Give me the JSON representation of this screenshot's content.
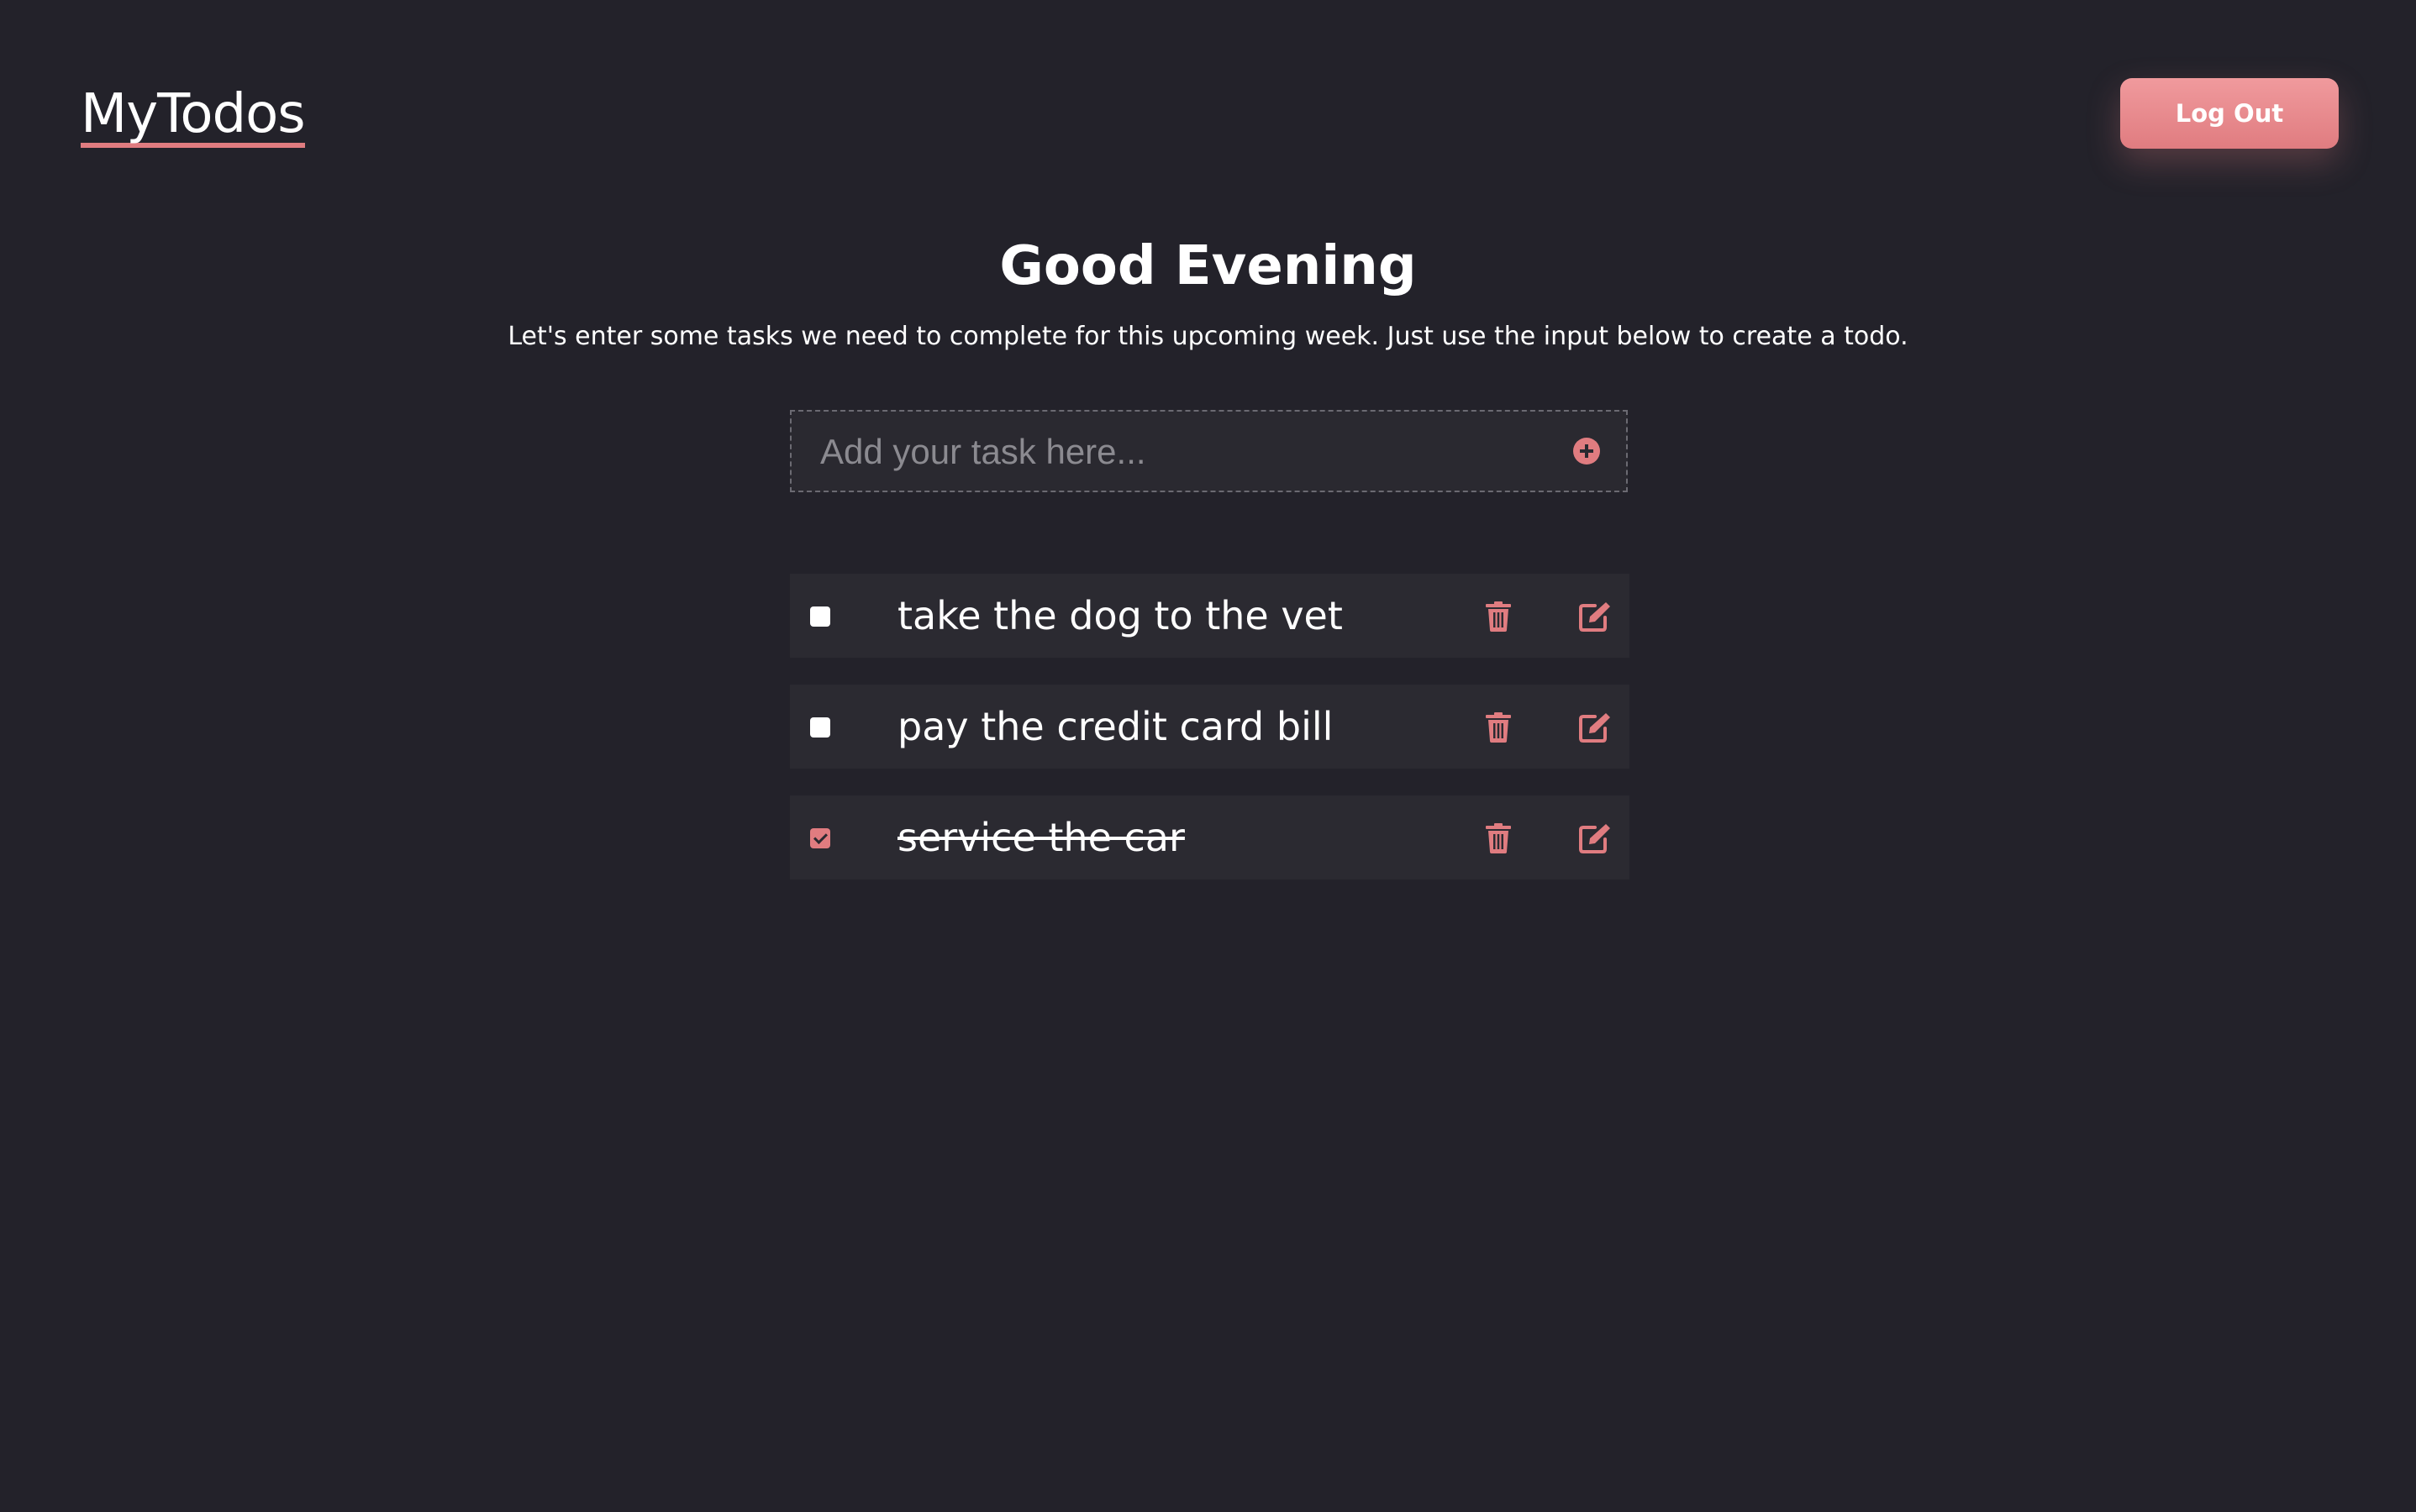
{
  "app": {
    "logo": "MyTodos",
    "logout_label": "Log Out"
  },
  "hero": {
    "greeting": "Good Evening",
    "subtitle": "Let's enter some tasks we need to complete for this upcoming week. Just use the input below to create a todo."
  },
  "add_task": {
    "placeholder": "Add your task here...",
    "value": "",
    "button_icon": "plus-circle-icon"
  },
  "todos": [
    {
      "text": "take the dog to the vet",
      "completed": false
    },
    {
      "text": "pay the credit card bill",
      "completed": false
    },
    {
      "text": "service the car",
      "completed": true
    }
  ],
  "icons": {
    "delete": "trash-icon",
    "edit": "edit-icon",
    "add": "plus-circle-icon"
  },
  "colors": {
    "background": "#23222a",
    "card": "#2b2a31",
    "accent": "#e07c80",
    "text": "#ffffff",
    "placeholder": "#8b8a90"
  }
}
